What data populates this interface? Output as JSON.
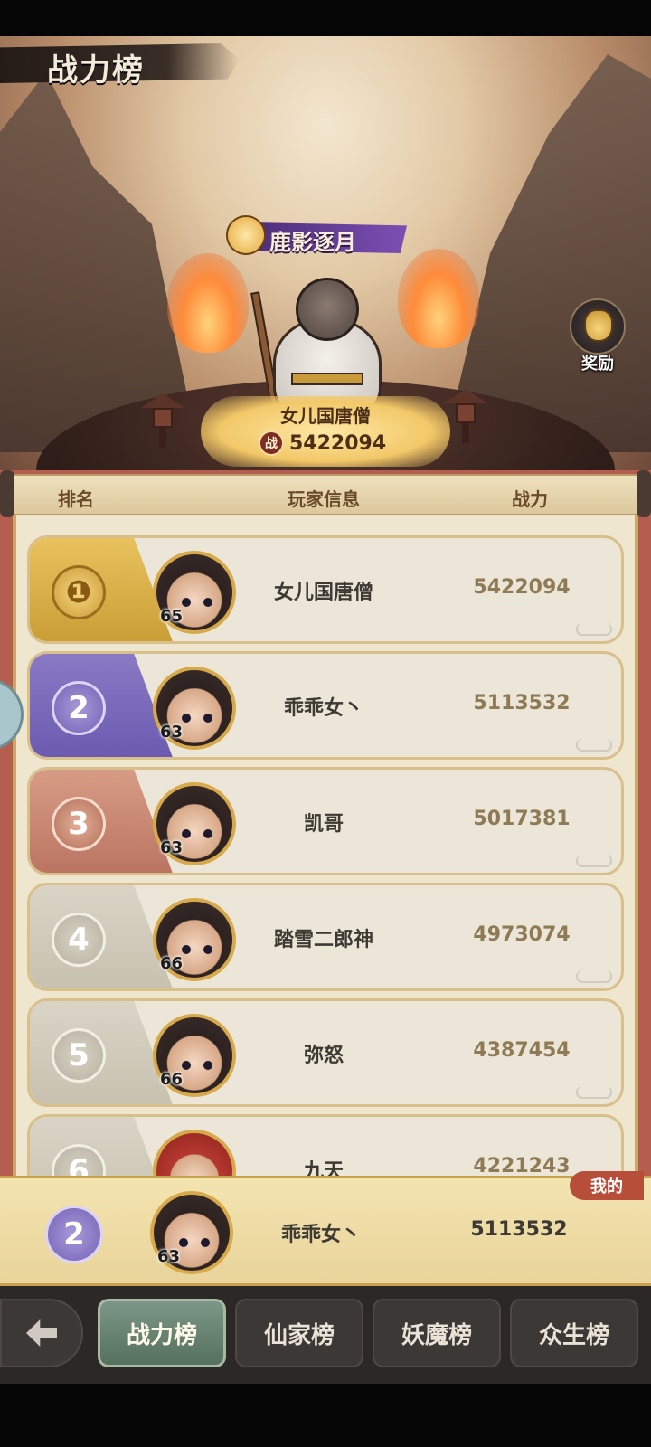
{
  "header": {
    "title": "战力榜"
  },
  "hero": {
    "skin_name": "鹿影逐月",
    "top_player_name": "女儿国唐僧",
    "power_badge": "战",
    "top_player_power": "5422094"
  },
  "reward": {
    "label": "奖励"
  },
  "columns": {
    "rank": "排名",
    "player_info": "玩家信息",
    "power": "战力"
  },
  "rankings": [
    {
      "rank": "1",
      "name": "女儿国唐僧",
      "level": "65",
      "power": "5422094"
    },
    {
      "rank": "2",
      "name": "乖乖女丶",
      "level": "63",
      "power": "5113532"
    },
    {
      "rank": "3",
      "name": "凯哥",
      "level": "63",
      "power": "5017381"
    },
    {
      "rank": "4",
      "name": "踏雪二郎神",
      "level": "66",
      "power": "4973074"
    },
    {
      "rank": "5",
      "name": "弥怒",
      "level": "66",
      "power": "4387454"
    },
    {
      "rank": "6",
      "name": "九天",
      "level": "",
      "power": "4221243"
    }
  ],
  "my_rank": {
    "tag": "我的",
    "rank": "2",
    "name": "乖乖女丶",
    "level": "63",
    "power": "5113532"
  },
  "tabs": [
    {
      "label": "战力榜",
      "active": true
    },
    {
      "label": "仙家榜",
      "active": false
    },
    {
      "label": "妖魔榜",
      "active": false
    },
    {
      "label": "众生榜",
      "active": false
    }
  ],
  "icons": {
    "back": "back-arrow-icon",
    "reward": "money-bag-icon",
    "rank_1": "first-place-medal-icon"
  }
}
